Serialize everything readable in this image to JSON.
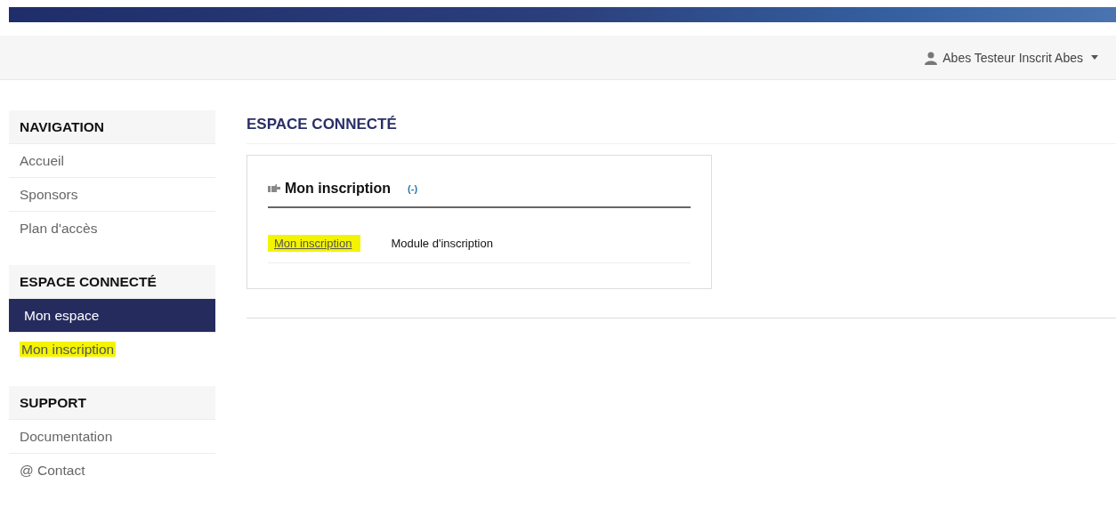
{
  "user_menu": {
    "label": "Abes Testeur Inscrit Abes"
  },
  "sidebar": {
    "sections": [
      {
        "title": "NAVIGATION",
        "items": [
          {
            "label": "Accueil",
            "selected": false,
            "highlighted": false
          },
          {
            "label": "Sponsors",
            "selected": false,
            "highlighted": false
          },
          {
            "label": "Plan d'accès",
            "selected": false,
            "highlighted": false
          }
        ]
      },
      {
        "title": "ESPACE CONNECTÉ",
        "items": [
          {
            "label": "Mon espace",
            "selected": true,
            "highlighted": false
          },
          {
            "label": "Mon inscription",
            "selected": false,
            "highlighted": true
          }
        ]
      },
      {
        "title": "SUPPORT",
        "items": [
          {
            "label": "Documentation",
            "selected": false,
            "highlighted": false
          },
          {
            "label": "@ Contact",
            "selected": false,
            "highlighted": false
          }
        ]
      }
    ]
  },
  "main": {
    "title": "ESPACE CONNECTÉ",
    "panel": {
      "title": "Mon inscription",
      "toggle": "(-)",
      "rows": [
        {
          "link": "Mon inscription",
          "highlighted": true,
          "description": "Module d'inscription"
        }
      ]
    }
  }
}
